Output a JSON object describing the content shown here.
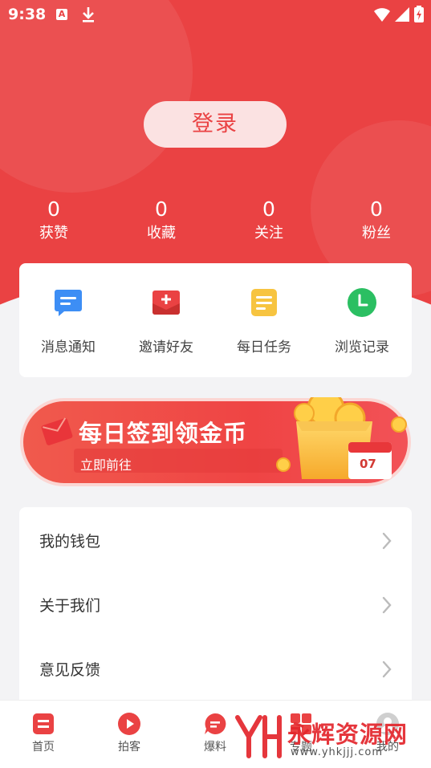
{
  "status_bar": {
    "time": "9:38",
    "a_badge": "A",
    "icons": [
      "a-notification-icon",
      "download-icon",
      "wifi-icon",
      "signal-icon",
      "battery-charging-icon"
    ]
  },
  "header": {
    "login_label": "登录",
    "stats": [
      {
        "value": "0",
        "label": "获赞"
      },
      {
        "value": "0",
        "label": "收藏"
      },
      {
        "value": "0",
        "label": "关注"
      },
      {
        "value": "0",
        "label": "粉丝"
      }
    ]
  },
  "quick_actions": [
    {
      "label": "消息通知",
      "icon": "message-notification-icon",
      "color": "#3d8ef5"
    },
    {
      "label": "邀请好友",
      "icon": "invite-envelope-icon",
      "color": "#ea4243"
    },
    {
      "label": "每日任务",
      "icon": "daily-task-icon",
      "color": "#f7c440"
    },
    {
      "label": "浏览记录",
      "icon": "history-clock-icon",
      "color": "#2bbf62"
    }
  ],
  "banner": {
    "title": "每日签到领金币",
    "subtitle": "立即前往",
    "calendar_day": "07"
  },
  "menu": {
    "items": [
      {
        "label": "我的钱包"
      },
      {
        "label": "关于我们"
      },
      {
        "label": "意见反馈"
      }
    ]
  },
  "tabbar": {
    "tabs": [
      {
        "label": "首页",
        "icon": "home-icon"
      },
      {
        "label": "拍客",
        "icon": "play-icon"
      },
      {
        "label": "爆料",
        "icon": "chat-bubble-icon"
      },
      {
        "label": "专题",
        "icon": "grid-icon"
      },
      {
        "label": "我的",
        "icon": "profile-icon"
      }
    ]
  },
  "watermark": {
    "text": "永辉资源网",
    "url": "www.yhkjjj.com"
  },
  "colors": {
    "brand_red": "#ea4243",
    "background": "#f3f3f5"
  }
}
